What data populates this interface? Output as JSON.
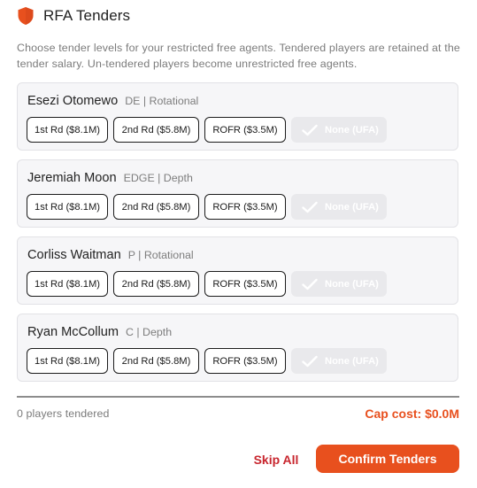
{
  "header": {
    "title": "RFA Tenders",
    "icon": "shield-icon"
  },
  "description": "Choose tender levels for your restricted free agents. Tendered players are retained at the tender salary. Un-tendered players become unrestricted free agents.",
  "options": [
    {
      "label": "1st Rd ($8.1M)"
    },
    {
      "label": "2nd Rd ($5.8M)"
    },
    {
      "label": "ROFR ($3.5M)"
    },
    {
      "label": "None (UFA)",
      "icon": "check-icon"
    }
  ],
  "players": [
    {
      "name": "Esezi Otomewo",
      "meta": "DE | Rotational"
    },
    {
      "name": "Jeremiah Moon",
      "meta": "EDGE | Depth"
    },
    {
      "name": "Corliss Waitman",
      "meta": "P | Rotational"
    },
    {
      "name": "Ryan McCollum",
      "meta": "C | Depth"
    }
  ],
  "footer": {
    "tendered_count": "0 players tendered",
    "cap_cost": "Cap cost: $0.0M",
    "skip_label": "Skip All",
    "confirm_label": "Confirm Tenders"
  },
  "colors": {
    "accent": "#e8501e",
    "skip": "#c8262e",
    "none_selected_bg": "#e9e9ec"
  }
}
